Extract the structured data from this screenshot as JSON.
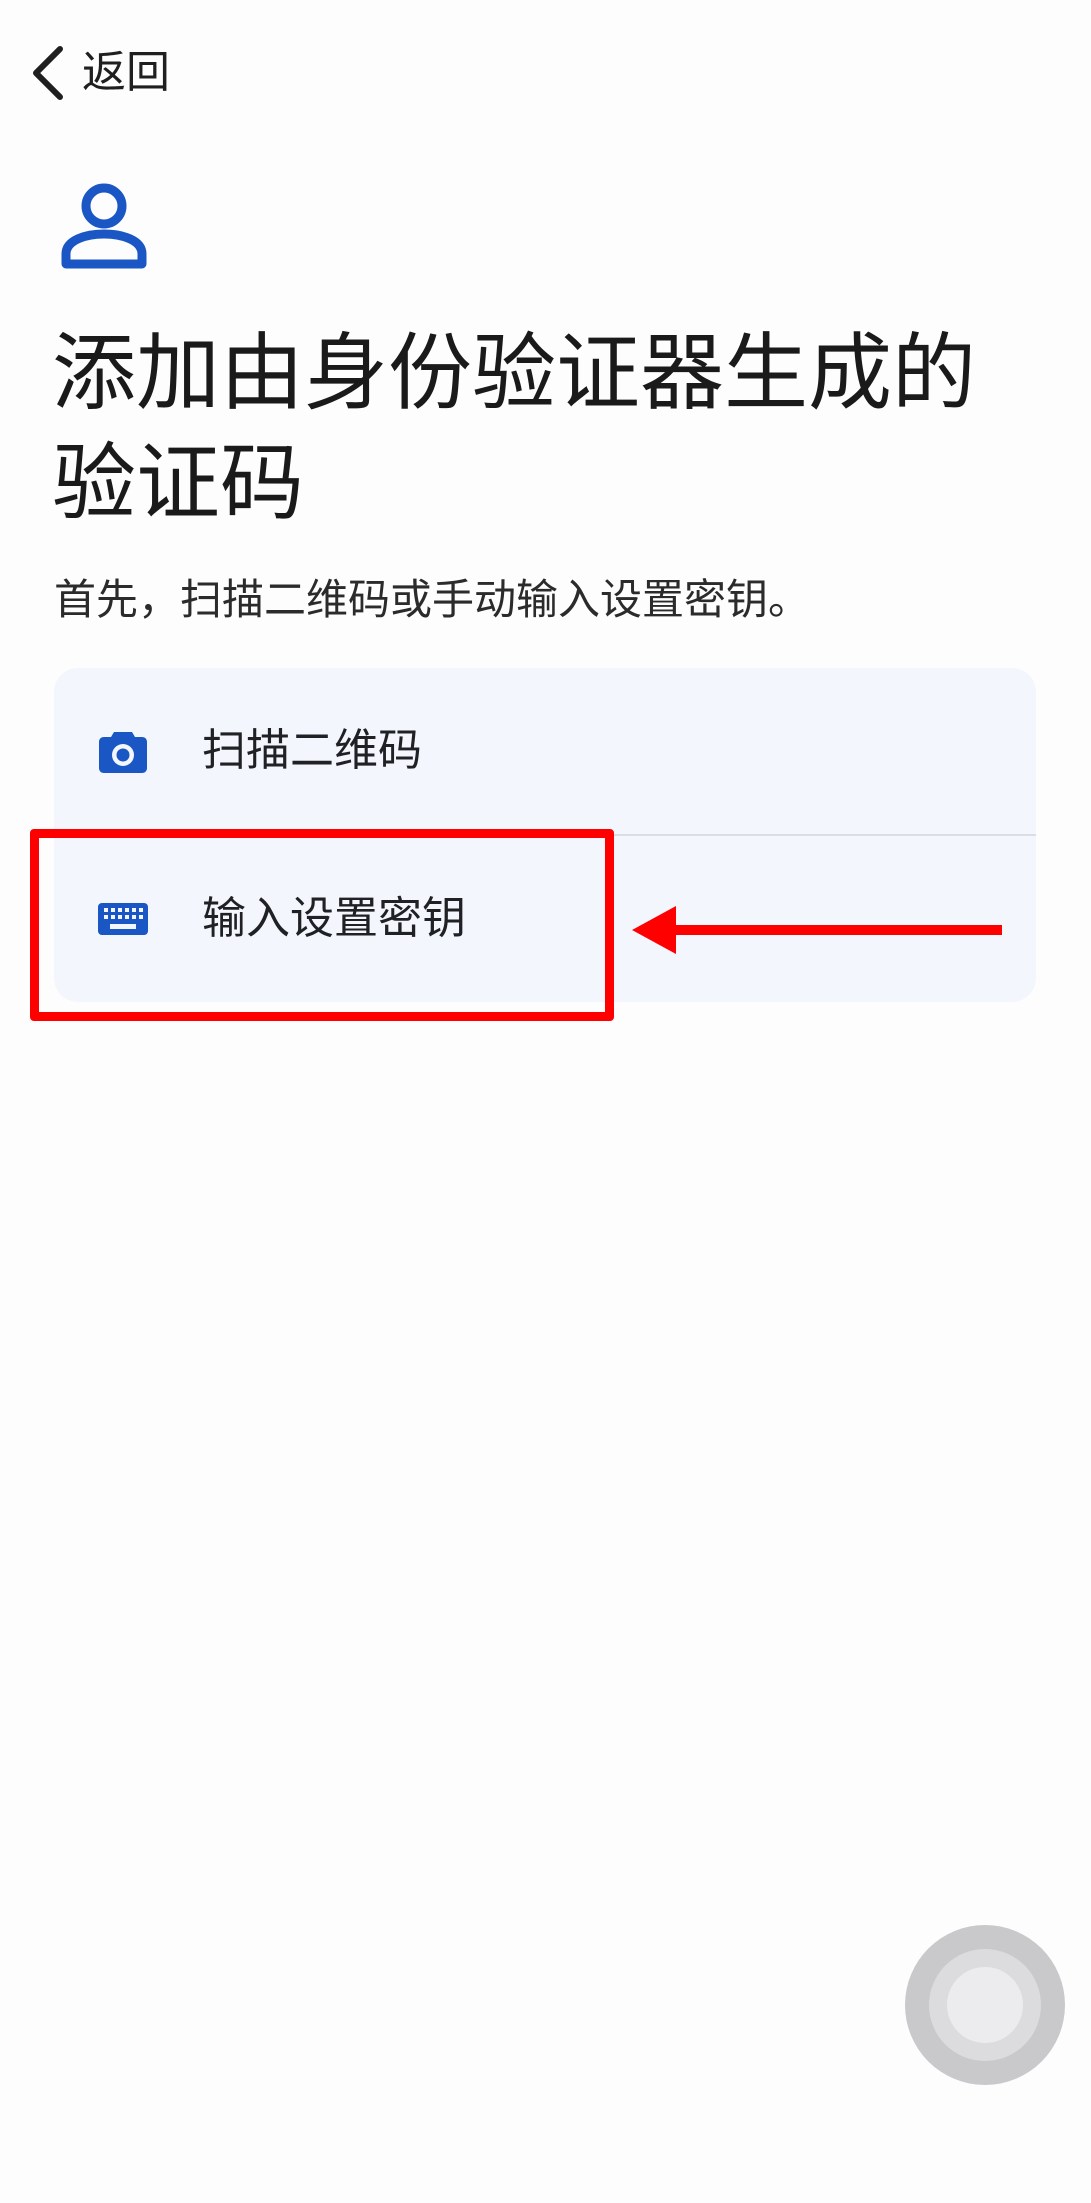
{
  "header": {
    "back_label": "返回"
  },
  "main": {
    "title": "添加由身份验证器生成的验证码",
    "subtitle": "首先，扫描二维码或手动输入设置密钥。"
  },
  "options": [
    {
      "label": "扫描二维码",
      "icon": "camera-icon"
    },
    {
      "label": "输入设置密钥",
      "icon": "keyboard-icon"
    }
  ],
  "colors": {
    "accent": "#1a56c4",
    "card_background": "#f3f6fd",
    "annotation": "#ff0000"
  }
}
